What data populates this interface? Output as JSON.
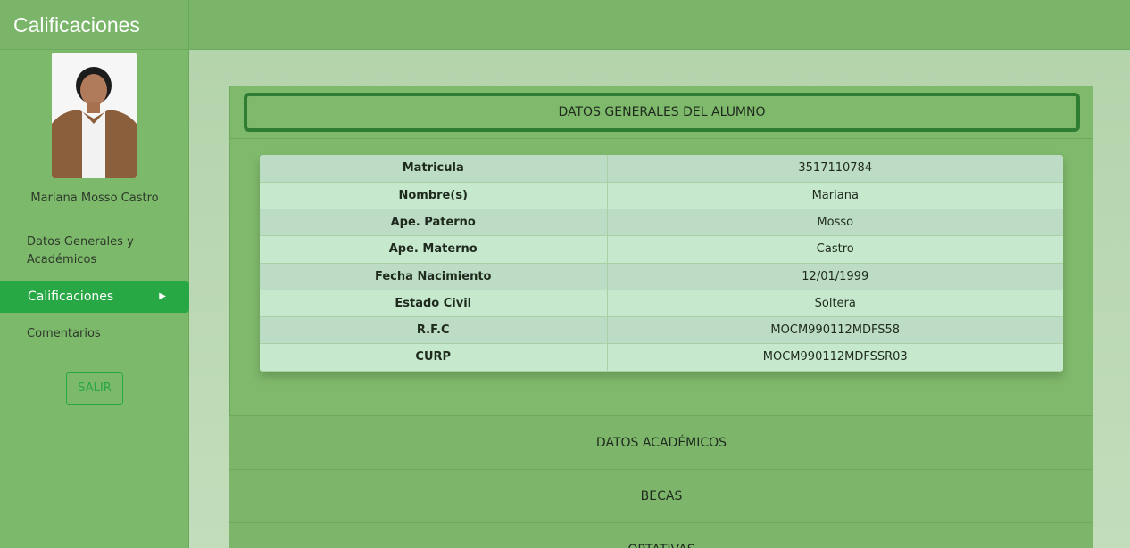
{
  "app": {
    "title": "Calificaciones"
  },
  "student": {
    "name": "Mariana Mosso Castro"
  },
  "sidebar": {
    "items": [
      {
        "label": "Datos Generales y Académicos"
      },
      {
        "label": "Calificaciones",
        "active": true
      },
      {
        "label": "Comentarios"
      }
    ],
    "logout_label": "SALIR"
  },
  "main": {
    "section_title": "DATOS GENERALES DEL ALUMNO",
    "general_data": [
      {
        "label": "Matricula",
        "value": "3517110784"
      },
      {
        "label": "Nombre(s)",
        "value": "Mariana"
      },
      {
        "label": "Ape. Paterno",
        "value": "Mosso"
      },
      {
        "label": "Ape. Materno",
        "value": "Castro"
      },
      {
        "label": "Fecha Nacimiento",
        "value": "12/01/1999"
      },
      {
        "label": "Estado Civil",
        "value": "Soltera"
      },
      {
        "label": "R.F.C",
        "value": "MOCM990112MDFS58"
      },
      {
        "label": "CURP",
        "value": "MOCM990112MDFSSR03"
      }
    ],
    "sections": [
      {
        "label": "DATOS ACADÉMICOS"
      },
      {
        "label": "BECAS"
      },
      {
        "label": "OPTATIVAS"
      }
    ]
  },
  "colors": {
    "accent": "#28a745",
    "sidebar_bg": "#7db96b",
    "header_border": "#2e7d32"
  }
}
